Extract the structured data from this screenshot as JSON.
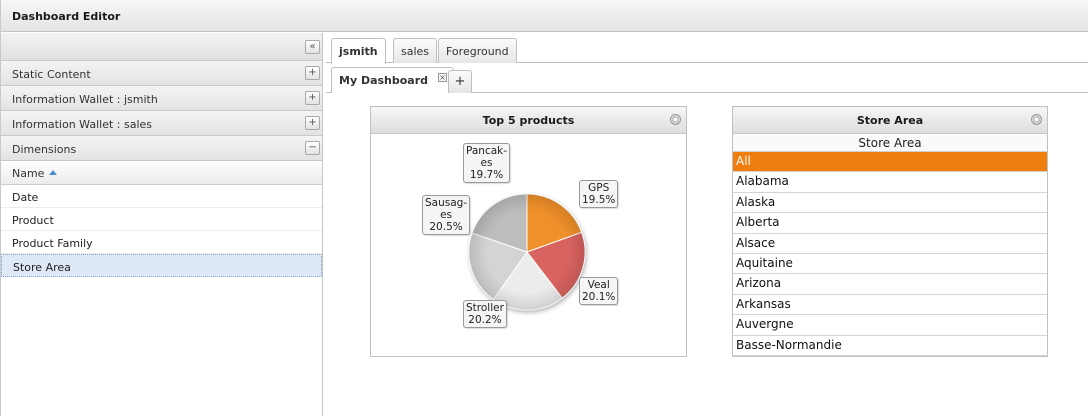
{
  "window": {
    "title": "Dashboard Editor"
  },
  "sidebar": {
    "collapse_glyph": "«",
    "sections": [
      {
        "label": "Static Content",
        "toggle": "+"
      },
      {
        "label": "Information Wallet : jsmith",
        "toggle": "+"
      },
      {
        "label": "Information Wallet : sales",
        "toggle": "+"
      },
      {
        "label": "Dimensions",
        "toggle": "−"
      }
    ],
    "list_header": "Name",
    "dimensions": [
      "Date",
      "Product",
      "Product Family",
      "Store Area"
    ],
    "selected_dimension": "Store Area"
  },
  "tabs": {
    "users": [
      "jsmith",
      "sales",
      "Foreground"
    ],
    "active_user": "jsmith",
    "dashboards": [
      "My Dashboard"
    ],
    "close_glyph": "×",
    "add_glyph": "+"
  },
  "pie_panel": {
    "title": "Top 5 products",
    "labels": [
      {
        "line1": "Pancak-",
        "line2": "es",
        "line3": "19.7%"
      },
      {
        "line1": "GPS",
        "line2": "19.5%"
      },
      {
        "line1": "Sausag-",
        "line2": "es",
        "line3": "20.5%"
      },
      {
        "line1": "Veal",
        "line2": "20.1%"
      },
      {
        "line1": "Stroller",
        "line2": "20.2%"
      }
    ]
  },
  "chart_data": {
    "type": "pie",
    "title": "Top 5 products",
    "categories": [
      "GPS",
      "Veal",
      "Stroller",
      "Sausages",
      "Pancakes"
    ],
    "values": [
      19.5,
      20.1,
      20.2,
      20.5,
      19.7
    ],
    "colors": [
      "#f0902a",
      "#d9645e",
      "#ececec",
      "#d4d4d4",
      "#bdbdbd"
    ]
  },
  "area_panel": {
    "title": "Store Area",
    "subtitle": "Store Area",
    "items": [
      "All",
      "Alabama",
      "Alaska",
      "Alberta",
      "Alsace",
      "Aquitaine",
      "Arizona",
      "Arkansas",
      "Auvergne",
      "Basse-Normandie"
    ],
    "selected": "All",
    "selected_color": "#f07e0f"
  }
}
